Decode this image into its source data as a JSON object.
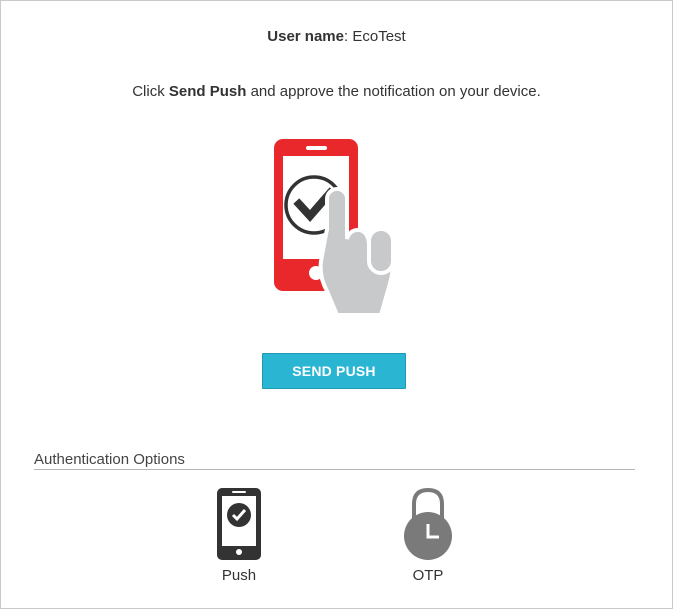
{
  "user": {
    "label": "User name",
    "separator": ": ",
    "value": "EcoTest"
  },
  "instruction": {
    "prefix": "Click ",
    "action": "Send Push",
    "suffix": " and approve the notification on your device."
  },
  "hero_icon": "phone-check-tap-icon",
  "send_button": {
    "label": "SEND PUSH"
  },
  "auth_options": {
    "title": "Authentication Options",
    "items": [
      {
        "label": "Push",
        "icon": "phone-check-icon"
      },
      {
        "label": "OTP",
        "icon": "clock-lock-icon"
      }
    ]
  },
  "colors": {
    "phone_red": "#e8282b",
    "button": "#2ab5d3",
    "hand": "#c8c9cb",
    "icon_dark": "#333333",
    "icon_grey": "#7a7a7a"
  }
}
